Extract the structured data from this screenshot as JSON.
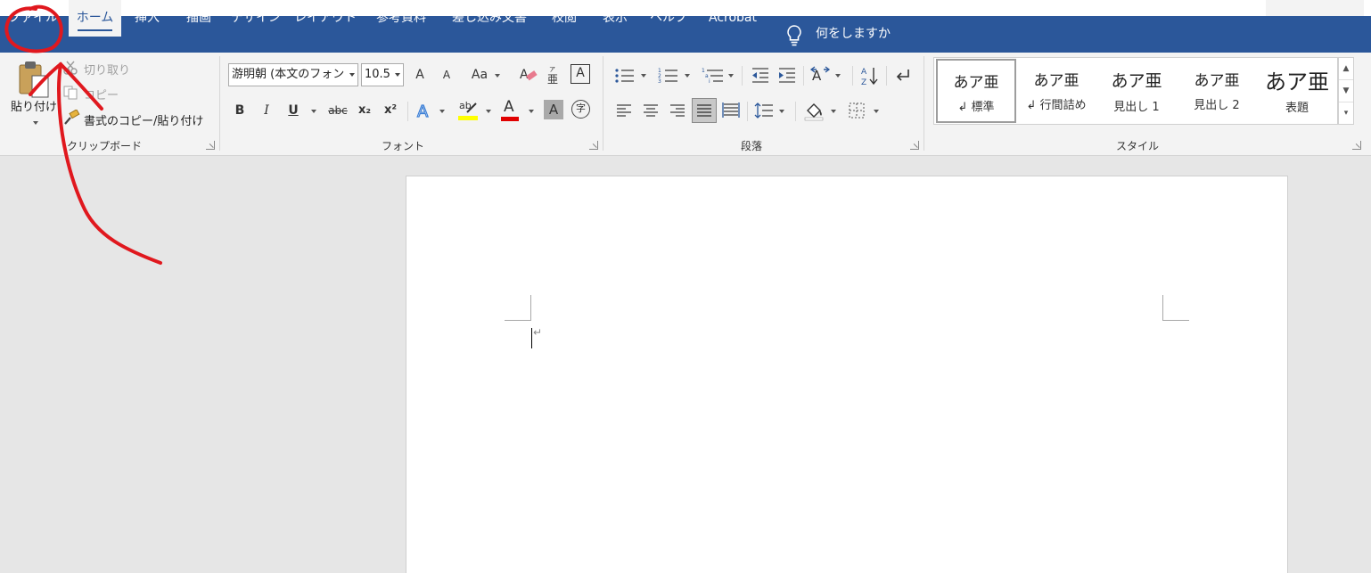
{
  "tabs": [
    {
      "label": "ファイル"
    },
    {
      "label": "ホーム"
    },
    {
      "label": "挿入"
    },
    {
      "label": "描画"
    },
    {
      "label": "デザイン"
    },
    {
      "label": "レイアウト"
    },
    {
      "label": "参考資料"
    },
    {
      "label": "差し込み文書"
    },
    {
      "label": "校閲"
    },
    {
      "label": "表示"
    },
    {
      "label": "ヘルプ"
    },
    {
      "label": "Acrobat"
    }
  ],
  "tell_me": "何をしますか",
  "clipboard": {
    "paste": "貼り付け",
    "cut": "切り取り",
    "copy": "コピー",
    "format_painter": "書式のコピー/貼り付け",
    "group": "クリップボード"
  },
  "font": {
    "name": "游明朝 (本文のフォン",
    "size": "10.5",
    "bold": "B",
    "italic": "I",
    "underline": "U",
    "strike": "abc",
    "sub": "x₂",
    "sup": "x²",
    "grow": "A",
    "shrink": "A",
    "case": "Aa",
    "highlight": "ab",
    "fontcolor": "A",
    "shading": "A",
    "enclose": "字",
    "border": "A",
    "group": "フォント"
  },
  "paragraph": {
    "group": "段落"
  },
  "styles": {
    "items": [
      {
        "sample": "あア亜",
        "name": "↲ 標準"
      },
      {
        "sample": "あア亜",
        "name": "↲ 行間詰め"
      },
      {
        "sample": "あア亜",
        "name": "見出し 1"
      },
      {
        "sample": "あア亜",
        "name": "見出し 2"
      },
      {
        "sample": "あア亜",
        "name": "表題"
      }
    ],
    "group": "スタイル"
  },
  "colors": {
    "tabbar": "#2b579a",
    "ribbon": "#f3f3f3",
    "highlight": "#ffff00",
    "fontcolor": "#e00000",
    "annotation": "#e0181e"
  },
  "document": {
    "pilcrow": "↵"
  }
}
